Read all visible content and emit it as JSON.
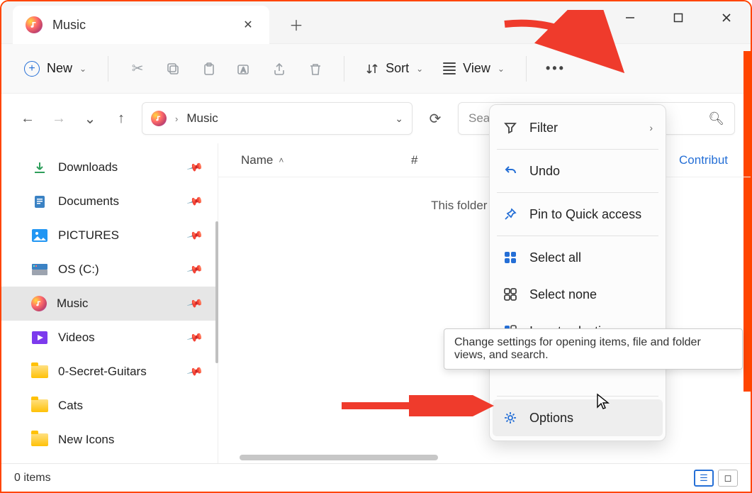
{
  "tab": {
    "title": "Music"
  },
  "toolbar": {
    "new_label": "New",
    "sort_label": "Sort",
    "view_label": "View"
  },
  "address": {
    "crumb": "Music"
  },
  "search": {
    "placeholder": "Search Music"
  },
  "sidebar": {
    "items": [
      {
        "label": "Downloads"
      },
      {
        "label": "Documents"
      },
      {
        "label": "PICTURES"
      },
      {
        "label": "OS (C:)"
      },
      {
        "label": "Music"
      },
      {
        "label": "Videos"
      },
      {
        "label": "0-Secret-Guitars"
      },
      {
        "label": "Cats"
      },
      {
        "label": "New Icons"
      }
    ]
  },
  "columns": {
    "name": "Name",
    "index": "#",
    "contrib": "Contribut"
  },
  "empty": "This folder is empty.",
  "context_menu": {
    "filter": "Filter",
    "undo": "Undo",
    "pin": "Pin to Quick access",
    "select_all": "Select all",
    "select_none": "Select none",
    "invert": "Invert selection",
    "options": "Options"
  },
  "tooltip": "Change settings for opening items, file and folder views, and search.",
  "status": {
    "count": "0 items"
  }
}
